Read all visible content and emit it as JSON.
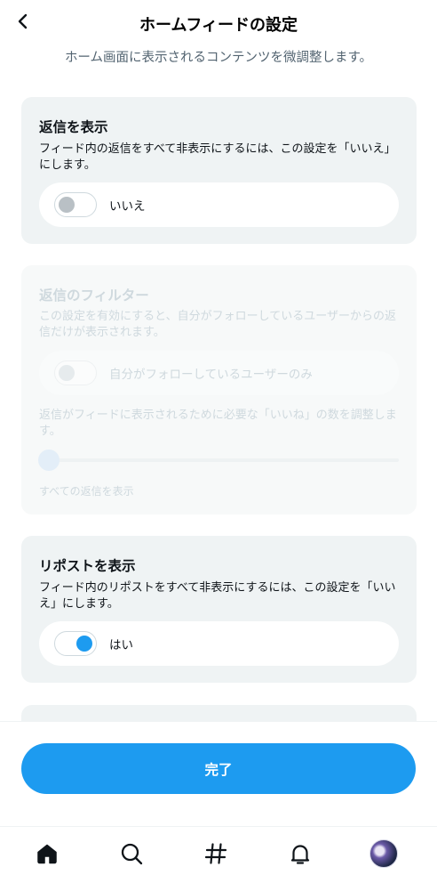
{
  "header": {
    "title": "ホームフィードの設定",
    "subtitle": "ホーム画面に表示されるコンテンツを微調整します。"
  },
  "cards": {
    "show_replies": {
      "title": "返信を表示",
      "description": "フィード内の返信をすべて非表示にするには、この設定を「いいえ」にします。",
      "toggle_label": "いいえ",
      "toggle_state": "off"
    },
    "reply_filter": {
      "title": "返信のフィルター",
      "description": "この設定を有効にすると、自分がフォローしているユーザーからの返信だけが表示されます。",
      "toggle_label": "自分がフォローしているユーザーのみ",
      "toggle_state": "off",
      "disabled": true,
      "slider_description": "返信がフィードに表示されるために必要な「いいね」の数を調整します。",
      "slider_value_label": "すべての返信を表示",
      "slider_value": 0
    },
    "show_reposts": {
      "title": "リポストを表示",
      "description": "フィード内のリポストをすべて非表示にするには、この設定を「いいえ」にします。",
      "toggle_label": "はい",
      "toggle_state": "on"
    }
  },
  "footer": {
    "done_label": "完了"
  },
  "tabbar": {
    "items": [
      "home-icon",
      "search-icon",
      "feeds-hash-icon",
      "notifications-bell-icon",
      "profile-avatar"
    ]
  },
  "colors": {
    "accent": "#1d9bf0",
    "card_bg": "#eff3f4",
    "text_primary": "#0f1419",
    "text_secondary": "#536471"
  }
}
